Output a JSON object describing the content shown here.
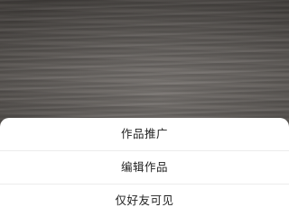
{
  "background": {
    "icon": "wood-texture-photo"
  },
  "action_sheet": {
    "items": [
      {
        "label": "作品推广"
      },
      {
        "label": "编辑作品"
      },
      {
        "label": "仅好友可见"
      }
    ]
  },
  "colors": {
    "sheet_background": "#ffffff",
    "text": "#1f1f1f",
    "divider": "#ececec"
  }
}
